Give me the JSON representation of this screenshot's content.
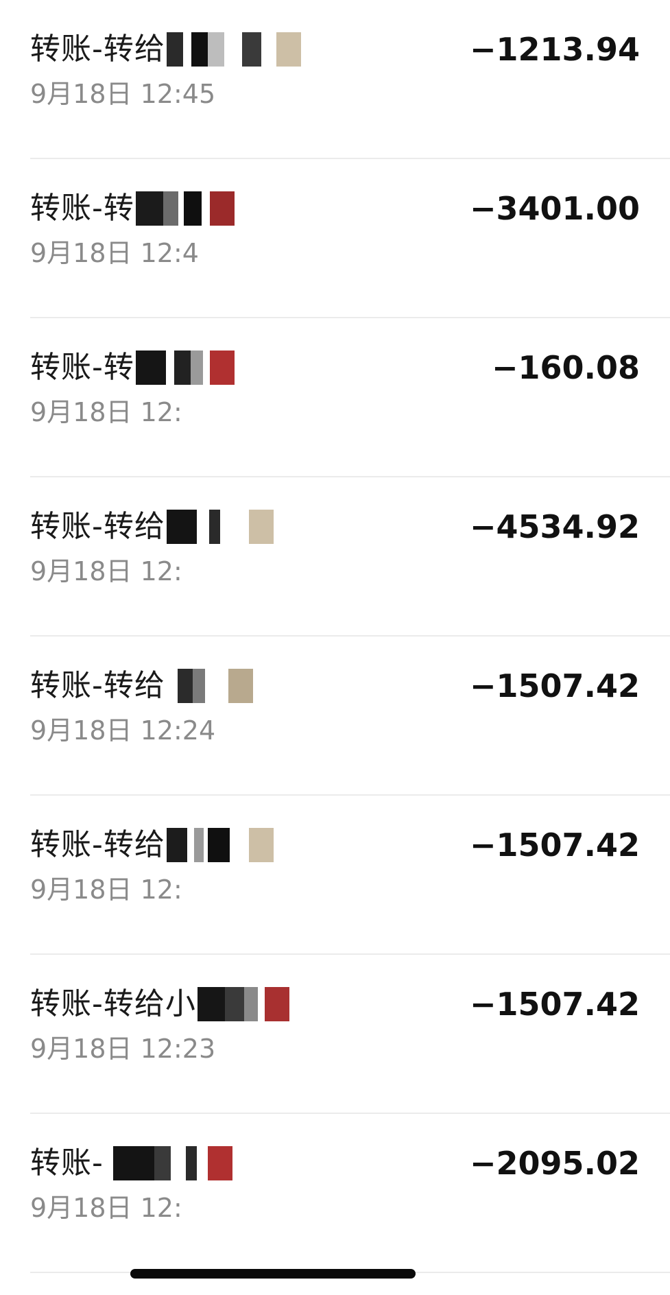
{
  "transactions": [
    {
      "title": "转账-转给",
      "time": "9月18日 12:45",
      "amount": "−1213.94"
    },
    {
      "title": "转账-转",
      "time": "9月18日 12:4",
      "amount": "−3401.00"
    },
    {
      "title": "转账-转",
      "time": "9月18日 12:",
      "amount": "−160.08"
    },
    {
      "title": "转账-转给",
      "time": "9月18日 12:",
      "amount": "−4534.92"
    },
    {
      "title": "转账-转给",
      "time": "9月18日 12:24",
      "amount": "−1507.42"
    },
    {
      "title": "转账-转给",
      "time": "9月18日 12:",
      "amount": "−1507.42"
    },
    {
      "title": "转账-转给小",
      "time": "9月18日 12:23",
      "amount": "−1507.42"
    },
    {
      "title": "转账-",
      "time": "9月18日 12:",
      "amount": "−2095.02"
    }
  ],
  "colors": {
    "title": "#1a1a1a",
    "time": "#8a8a8a",
    "amount": "#111111",
    "divider": "#ebebeb",
    "home_indicator": "#0a0a0a"
  }
}
